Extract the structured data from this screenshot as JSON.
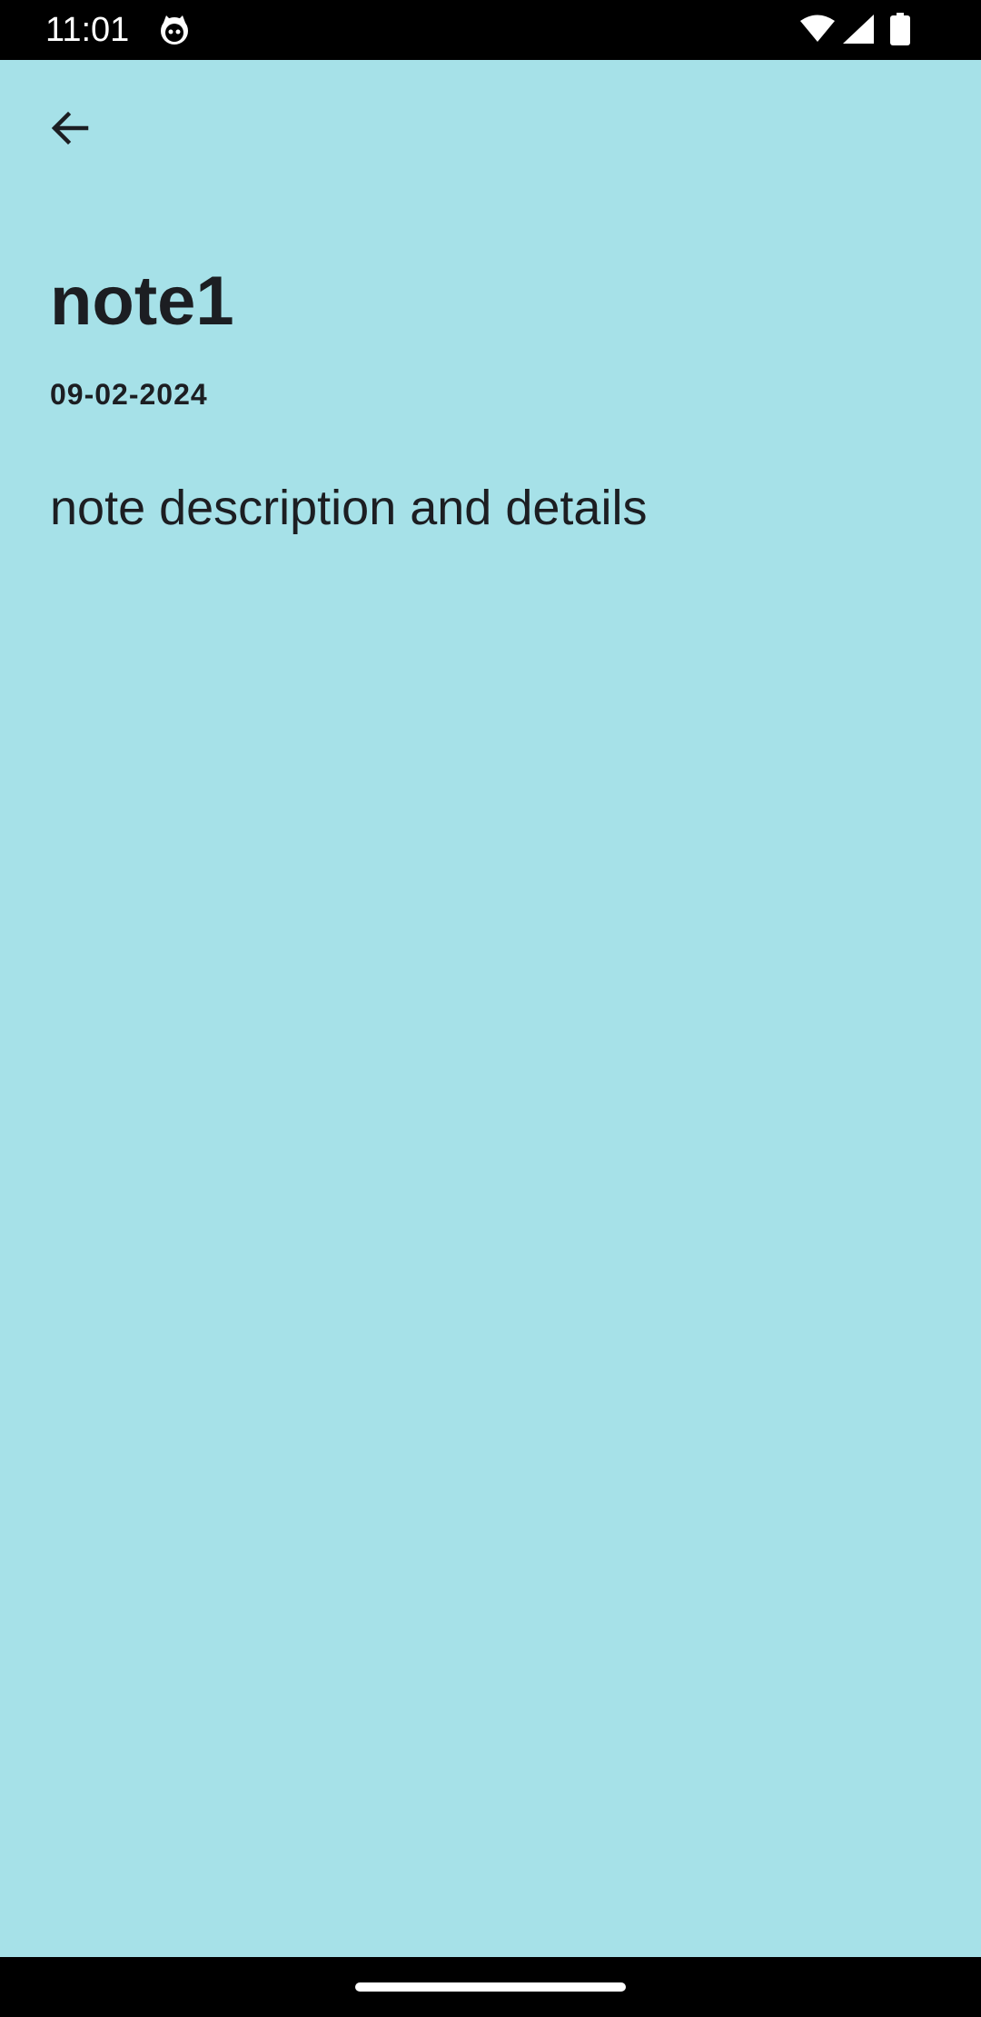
{
  "status_bar": {
    "time": "11:01",
    "app_icon": "cat-face-icon",
    "wifi_icon": "wifi-icon",
    "signal_icon": "cellular-signal-icon",
    "battery_icon": "battery-icon"
  },
  "toolbar": {
    "back_icon": "arrow-back-icon"
  },
  "note": {
    "title": "note1",
    "date": "09-02-2024",
    "description": "note description and details"
  },
  "colors": {
    "background": "#a6e1e8",
    "text": "#1c1e22",
    "system_bars": "#000000"
  }
}
